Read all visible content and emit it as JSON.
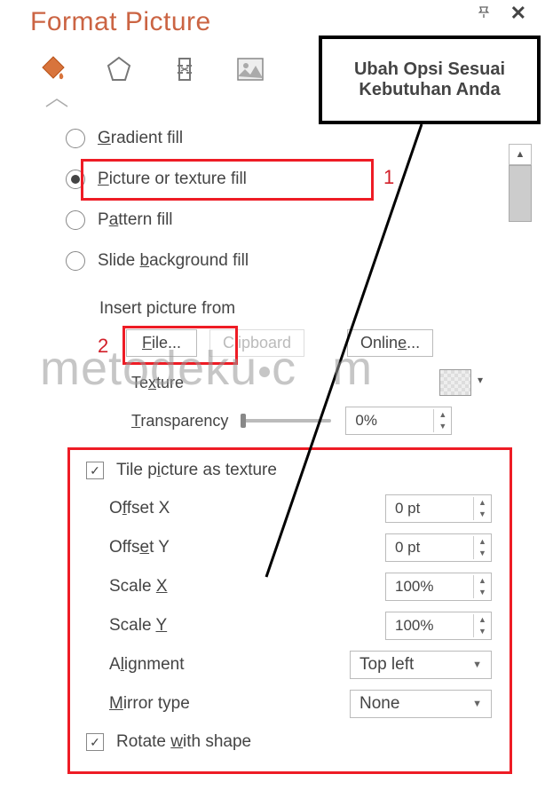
{
  "title": "Format Picture",
  "fillOptions": {
    "gradient": "Gradient fill",
    "picture": "Picture or texture fill",
    "pattern": "Pattern fill",
    "slideBg": "Slide background fill"
  },
  "insert": {
    "label": "Insert picture from",
    "file": "File...",
    "clipboard": "Clipboard",
    "online": "Online..."
  },
  "texture": {
    "label": "Texture",
    "transparencyLabel": "Transparency",
    "transparencyValue": "0%"
  },
  "tile": {
    "check": "Tile picture as texture",
    "offsetXLabel": "Offset X",
    "offsetXValue": "0 pt",
    "offsetYLabel": "Offset Y",
    "offsetYValue": "0 pt",
    "scaleXLabel": "Scale X",
    "scaleXValue": "100%",
    "scaleYLabel": "Scale Y",
    "scaleYValue": "100%",
    "alignmentLabel": "Alignment",
    "alignmentValue": "Top left",
    "mirrorLabel": "Mirror type",
    "mirrorValue": "None",
    "rotate": "Rotate with shape"
  },
  "annotations": {
    "n1": "1",
    "n2": "2",
    "callout": "Ubah Opsi Sesuai Kebutuhan Anda"
  },
  "watermark": {
    "p1": "metodeku",
    "p2": "c",
    "p3": "m"
  }
}
